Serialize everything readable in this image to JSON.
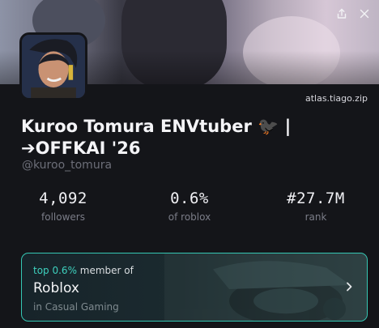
{
  "profile": {
    "name": "Kuroo Tomura ENVtuber 🐦‍⬛ | ➔OFFKAI '26",
    "handle": "@kuroo_tomura",
    "site": "atlas.tiago.zip"
  },
  "stats": [
    {
      "value": "4,092",
      "label": "followers"
    },
    {
      "value": "0.6%",
      "label": "of roblox"
    },
    {
      "value": "#27.7M",
      "label": "rank"
    }
  ],
  "community_card": {
    "prefix": "top 0.6%",
    "suffix": "member of",
    "title": "Roblox",
    "subtitle": "in Casual Gaming"
  },
  "icons": {
    "share": "share-icon",
    "close": "close-icon",
    "chevron": "chevron-right-icon"
  },
  "colors": {
    "background": "#141519",
    "accent": "#3ed1be",
    "card_border": "#35c7b4"
  }
}
